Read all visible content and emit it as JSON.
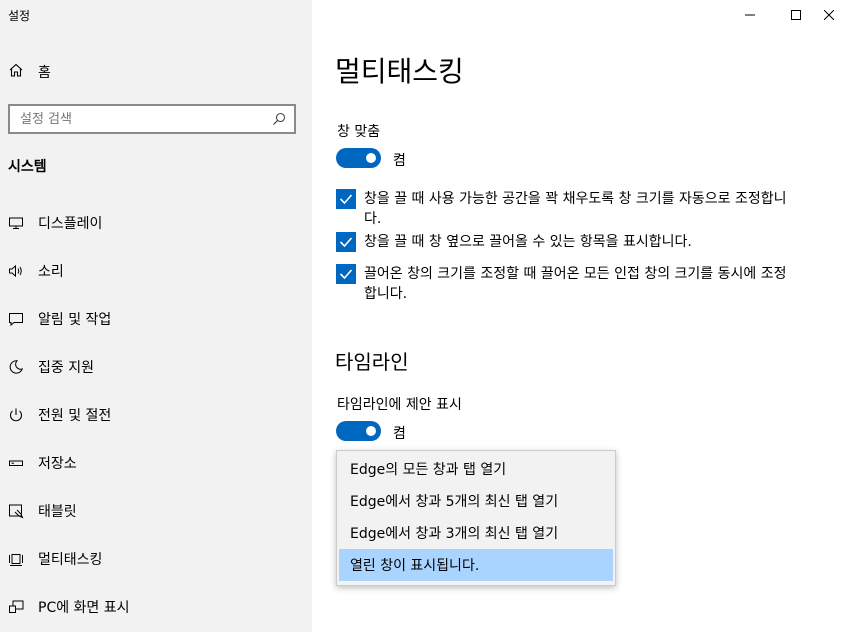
{
  "window": {
    "title": "설정",
    "minimize": "—",
    "maximize": "☐",
    "close": "✕"
  },
  "sidebar": {
    "home_label": "홈",
    "search_placeholder": "설정 검색",
    "section_title": "시스템",
    "items": [
      {
        "label": "디스플레이",
        "icon": "display-icon"
      },
      {
        "label": "소리",
        "icon": "speaker-icon"
      },
      {
        "label": "알림 및 작업",
        "icon": "notification-icon"
      },
      {
        "label": "집중 지원",
        "icon": "moon-icon"
      },
      {
        "label": "전원 및 절전",
        "icon": "power-icon"
      },
      {
        "label": "저장소",
        "icon": "storage-icon"
      },
      {
        "label": "태블릿",
        "icon": "tablet-icon"
      },
      {
        "label": "멀티태스킹",
        "icon": "multitasking-icon"
      },
      {
        "label": "PC에 화면 표시",
        "icon": "project-icon"
      }
    ]
  },
  "main": {
    "title": "멀티태스킹",
    "snap": {
      "label": "창 맞춤",
      "toggle_state": "켬",
      "toggle_on": true,
      "options": [
        {
          "text": "창을 끌 때 사용 가능한 공간을 꽉 채우도록 창 크기를 자동으로 조정합니다.",
          "checked": true
        },
        {
          "text": "창을 끌 때 창 옆으로 끌어올 수 있는 항목을 표시합니다.",
          "checked": true
        },
        {
          "text": "끌어온 창의 크기를 조정할 때 끌어온 모든 인접 창의 크기를 동시에 조정합니다.",
          "checked": true
        }
      ]
    },
    "timeline": {
      "title": "타임라인",
      "label": "타임라인에 제안 표시",
      "toggle_state": "켬",
      "toggle_on": true
    },
    "dropdown": {
      "options": [
        "Edge의 모든 창과 탭 열기",
        "Edge에서 창과 5개의 최신 탭 열기",
        "Edge에서 창과 3개의 최신 탭 열기",
        "열린 창이 표시됩니다."
      ],
      "selected_index": 3
    }
  },
  "colors": {
    "accent": "#0067c0",
    "sidebar_bg": "#f2f2f2",
    "dropdown_selected": "#a8d4ff"
  }
}
